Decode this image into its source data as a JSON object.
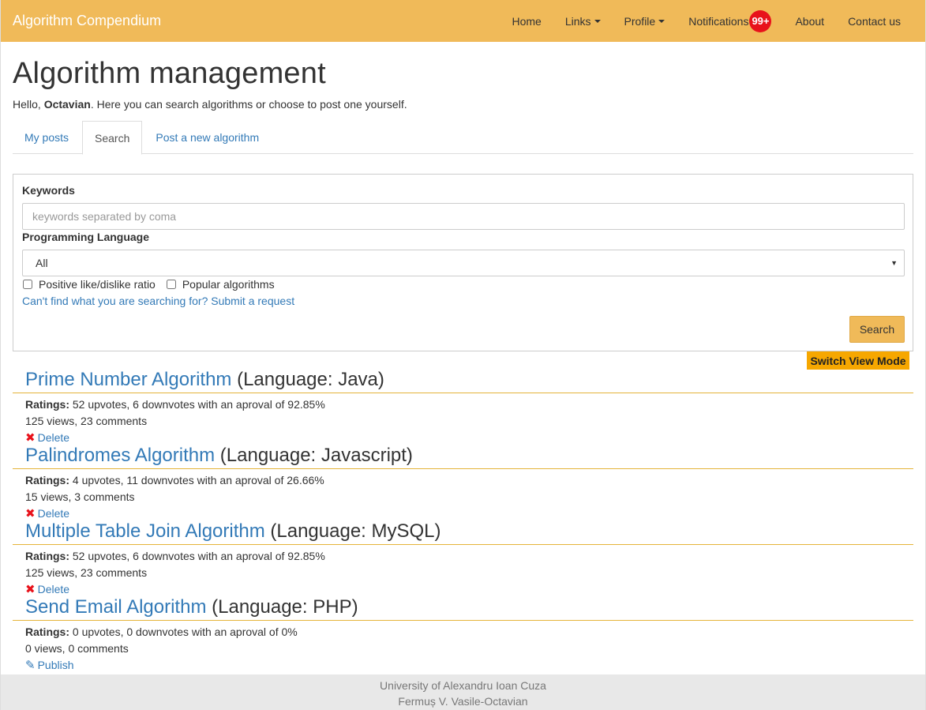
{
  "navbar": {
    "brand": "Algorithm Compendium",
    "items": [
      {
        "label": "Home"
      },
      {
        "label": "Links"
      },
      {
        "label": "Profile"
      },
      {
        "label": "Notifications"
      },
      {
        "label": "About"
      },
      {
        "label": "Contact us"
      }
    ],
    "notification_badge": "99+"
  },
  "header": {
    "title": "Algorithm management",
    "greeting_prefix": "Hello, ",
    "user": "Octavian",
    "greeting_suffix": ". Here you can search algorithms or choose to post one yourself."
  },
  "tabs": [
    {
      "label": "My posts"
    },
    {
      "label": "Search"
    },
    {
      "label": "Post a new algorithm"
    }
  ],
  "search": {
    "keywords_label": "Keywords",
    "keywords_placeholder": "keywords separated by coma",
    "keywords_value": "",
    "language_label": "Programming Language",
    "language_selected": "All",
    "check_positive": "Positive like/dislike ratio",
    "check_popular": "Popular algorithms",
    "request_link": "Can't find what you are searching for? Submit a request",
    "search_button": "Search"
  },
  "switch_view_button": "Switch View Mode",
  "results": [
    {
      "title": "Prime Number Algorithm",
      "language": "(Language: Java)",
      "ratings_label": "Ratings:",
      "ratings": "52 upvotes, 6 downvotes with an aproval of 92.85%",
      "stats": "125 views, 23 comments",
      "action": "Delete"
    },
    {
      "title": "Palindromes Algorithm",
      "language": "(Language: Javascript)",
      "ratings_label": "Ratings:",
      "ratings": "4 upvotes, 11 downvotes with an aproval of 26.66%",
      "stats": "15 views, 3 comments",
      "action": "Delete"
    },
    {
      "title": "Multiple Table Join Algorithm",
      "language": "(Language: MySQL)",
      "ratings_label": "Ratings:",
      "ratings": "52 upvotes, 6 downvotes with an aproval of 92.85%",
      "stats": "125 views, 23 comments",
      "action": "Delete"
    },
    {
      "title": "Send Email Algorithm",
      "language": "(Language: PHP)",
      "ratings_label": "Ratings:",
      "ratings": "0 upvotes, 0 downvotes with an aproval of 0%",
      "stats": "0 views, 0 comments",
      "action": "Publish"
    }
  ],
  "footer": {
    "line1": "University of Alexandru Ioan Cuza",
    "line2": "Fermuș V. Vasile-Octavian"
  },
  "colors": {
    "navbar": "#f0ba59",
    "switch_button": "#f6a700",
    "badge": "#e8121b",
    "link": "#337ab7"
  }
}
